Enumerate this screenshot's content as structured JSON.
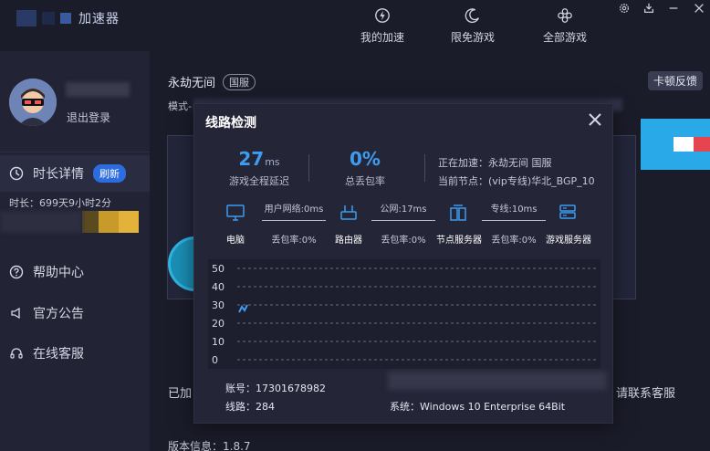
{
  "app": {
    "name": "加速器"
  },
  "nav": {
    "items": [
      {
        "label": "我的加速",
        "icon": "lightning-icon"
      },
      {
        "label": "限免游戏",
        "icon": "moon-icon"
      },
      {
        "label": "全部游戏",
        "icon": "flower-icon"
      }
    ]
  },
  "sidebar": {
    "logout": "退出登录",
    "duration_title": "时长详情",
    "refresh_badge": "刷新",
    "duration_value": "时长：699天9小时2分",
    "help": "帮助中心",
    "notice": "官方公告",
    "service": "在线客服"
  },
  "main": {
    "game_name": "永劫无间",
    "server_tag": "国服",
    "stuck_feedback": "卡顿反馈",
    "mode_prefix": "模式-",
    "notice_left": "已加",
    "notice_right": "请联系客服",
    "version": "版本信息：1.8.7"
  },
  "modal": {
    "title": "线路检测",
    "latency_value": "27",
    "latency_unit": "ms",
    "latency_label": "游戏全程延迟",
    "loss_value": "0%",
    "loss_label": "总丢包率",
    "accelerating": "正在加速：永劫无间 国服",
    "current_node": "当前节点：(vip专线)华北_BGP_10",
    "nodes": [
      "电脑",
      "路由器",
      "节点服务器",
      "游戏服务器"
    ],
    "links": [
      {
        "top": "用户网络:0ms",
        "bottom": "丢包率:0%"
      },
      {
        "top": "公网:17ms",
        "bottom": "丢包率:0%"
      },
      {
        "top": "专线:10ms",
        "bottom": "丢包率:0%"
      }
    ],
    "account": "账号：17301678982",
    "route": "线路：284",
    "system": "系统：Windows 10 Enterprise 64Bit"
  },
  "chart_data": {
    "type": "line",
    "y_ticks": [
      "50",
      "40",
      "30",
      "20",
      "10",
      "0"
    ],
    "ylim": [
      0,
      50
    ],
    "series": [
      {
        "values": [
          26,
          29,
          27,
          30
        ]
      }
    ],
    "grid": true,
    "line_color": "#3d9cf0"
  }
}
